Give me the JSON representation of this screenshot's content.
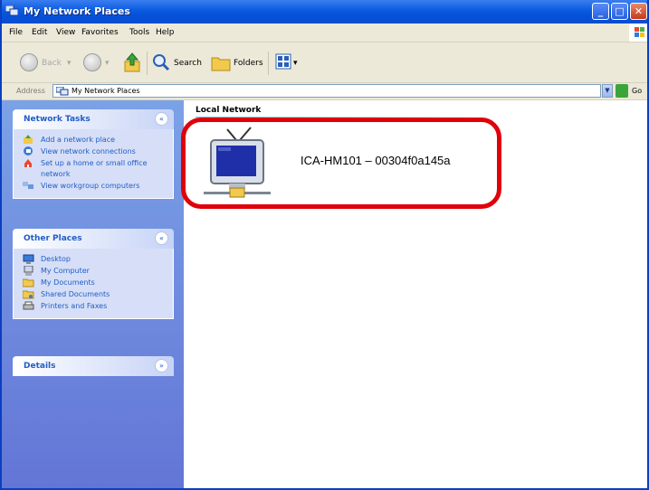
{
  "window": {
    "title": "My Network Places"
  },
  "menu": {
    "items": [
      "File",
      "Edit",
      "View",
      "Favorites",
      "Tools",
      "Help"
    ]
  },
  "toolbar": {
    "back": "Back",
    "search": "Search",
    "folders": "Folders"
  },
  "address": {
    "label": "Address",
    "value": "My Network Places",
    "go": "Go"
  },
  "tasks": {
    "network_tasks": {
      "title": "Network Tasks",
      "items": [
        {
          "label": "Add a network place",
          "icon": "add-network-place-icon"
        },
        {
          "label": "View network connections",
          "icon": "network-connections-icon"
        },
        {
          "label": "Set up a home or small office network",
          "icon": "setup-network-icon"
        },
        {
          "label": "View workgroup computers",
          "icon": "workgroup-icon"
        }
      ]
    },
    "other_places": {
      "title": "Other Places",
      "items": [
        {
          "label": "Desktop",
          "icon": "desktop-icon"
        },
        {
          "label": "My Computer",
          "icon": "my-computer-icon"
        },
        {
          "label": "My Documents",
          "icon": "my-documents-icon"
        },
        {
          "label": "Shared Documents",
          "icon": "shared-documents-icon"
        },
        {
          "label": "Printers and Faxes",
          "icon": "printers-faxes-icon"
        }
      ]
    },
    "details": {
      "title": "Details"
    }
  },
  "content": {
    "group": "Local Network",
    "device": {
      "name": "ICA-HM101 – 00304f0a145a",
      "icon": "network-camera-device-icon"
    }
  },
  "colors": {
    "title_bar": "#0a5ae0",
    "task_pane": "#6f8ee0",
    "highlight": "#e0000a",
    "link": "#215dc6"
  }
}
